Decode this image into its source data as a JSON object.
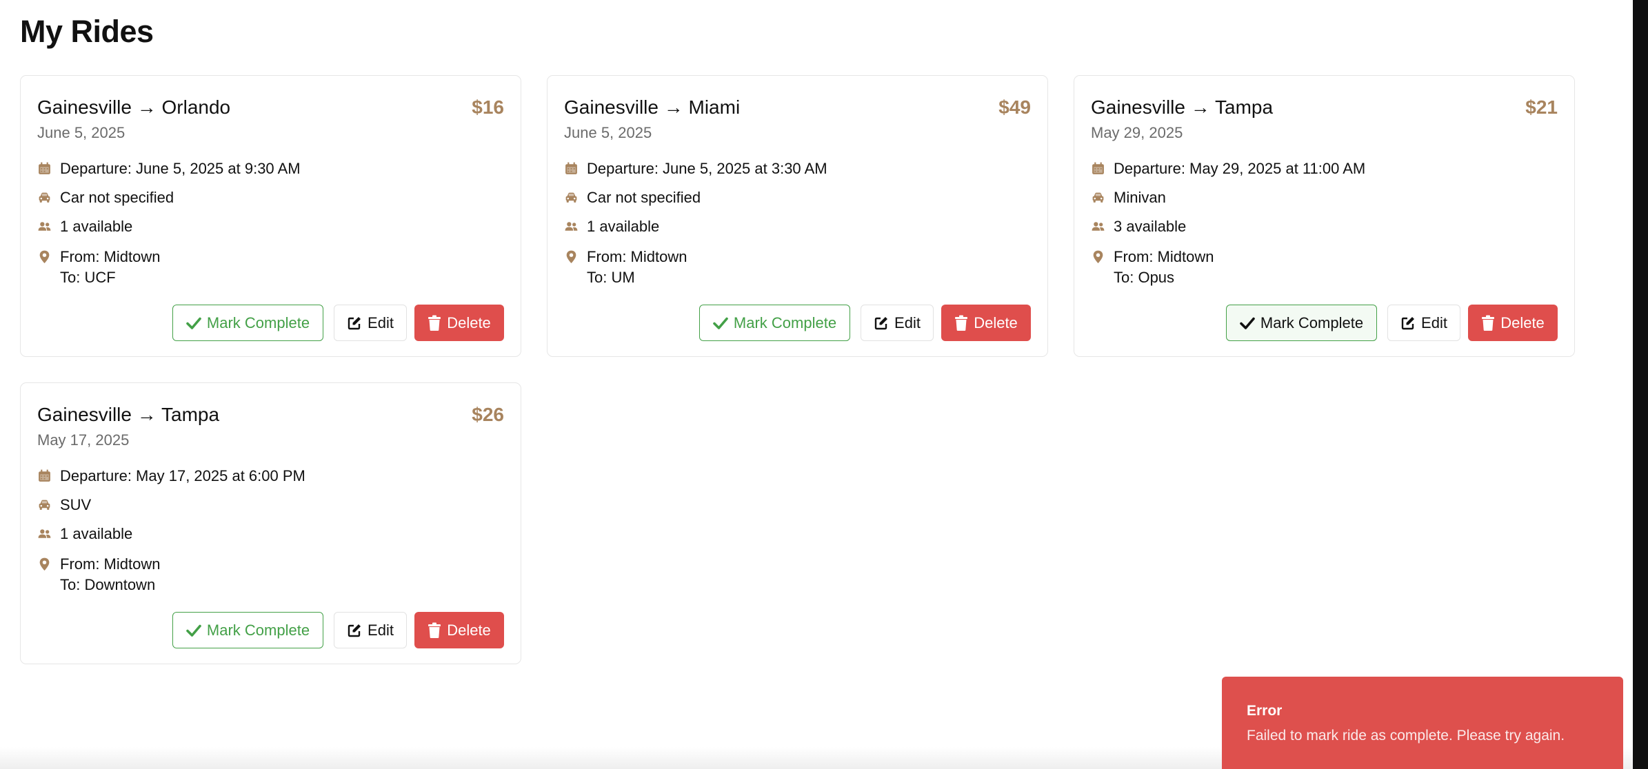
{
  "page": {
    "title": "My Rides"
  },
  "colors": {
    "accent_brown": "#a8845e",
    "success_green": "#43a047",
    "danger_red": "#df4e4c",
    "muted_text": "#6b6b6b"
  },
  "icons": {
    "departure": "calendar-icon",
    "car": "car-icon",
    "seats": "users-icon",
    "location": "map-pin-icon",
    "mark_complete": "check-icon",
    "edit": "edit-icon",
    "delete": "trash-icon"
  },
  "rides": [
    {
      "route": "Gainesville → Orlando",
      "price": "$16",
      "date": "June 5, 2025",
      "departure": "Departure: June 5, 2025 at 9:30 AM",
      "car": "Car not specified",
      "seats": "1 available",
      "from": "From: Midtown",
      "to": "To: UCF",
      "buttons": {
        "complete": "Mark Complete",
        "edit": "Edit",
        "delete": "Delete"
      }
    },
    {
      "route": "Gainesville → Miami",
      "price": "$49",
      "date": "June 5, 2025",
      "departure": "Departure: June 5, 2025 at 3:30 AM",
      "car": "Car not specified",
      "seats": "1 available",
      "from": "From: Midtown",
      "to": "To: UM",
      "buttons": {
        "complete": "Mark Complete",
        "edit": "Edit",
        "delete": "Delete"
      }
    },
    {
      "route": "Gainesville → Tampa",
      "price": "$21",
      "date": "May 29, 2025",
      "departure": "Departure: May 29, 2025 at 11:00 AM",
      "car": "Minivan",
      "seats": "3 available",
      "from": "From: Midtown",
      "to": "To: Opus",
      "buttons": {
        "complete": "Mark Complete",
        "edit": "Edit",
        "delete": "Delete"
      }
    },
    {
      "route": "Gainesville → Tampa",
      "price": "$26",
      "date": "May 17, 2025",
      "departure": "Departure: May 17, 2025 at 6:00 PM",
      "car": "SUV",
      "seats": "1 available",
      "from": "From: Midtown",
      "to": "To: Downtown",
      "buttons": {
        "complete": "Mark Complete",
        "edit": "Edit",
        "delete": "Delete"
      }
    }
  ],
  "toast": {
    "title": "Error",
    "message": "Failed to mark ride as complete. Please try again."
  }
}
